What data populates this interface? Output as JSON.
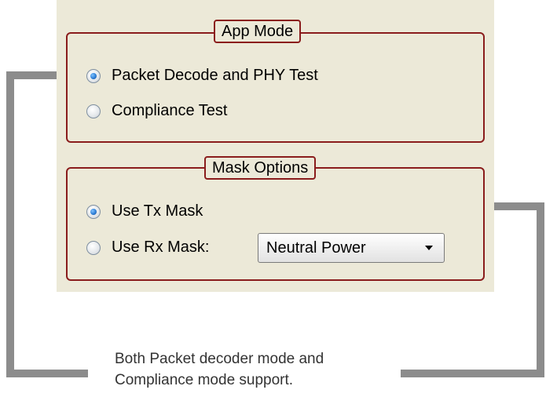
{
  "app_mode": {
    "title": "App Mode",
    "options": [
      {
        "label": "Packet Decode and PHY Test",
        "selected": true
      },
      {
        "label": "Compliance Test",
        "selected": false
      }
    ]
  },
  "mask_options": {
    "title": "Mask Options",
    "options": [
      {
        "label": "Use Tx Mask",
        "selected": true
      },
      {
        "label": "Use Rx Mask:",
        "selected": false
      }
    ],
    "rx_mask_select": {
      "value": "Neutral Power"
    }
  },
  "caption": {
    "line1": "Both Packet decoder mode and",
    "line2": "Compliance mode support."
  },
  "colors": {
    "panel_bg": "#ece9d8",
    "group_border": "#8a1c1c",
    "arrow": "#8c8c8c",
    "radio_selected": "#2f7fd6"
  }
}
